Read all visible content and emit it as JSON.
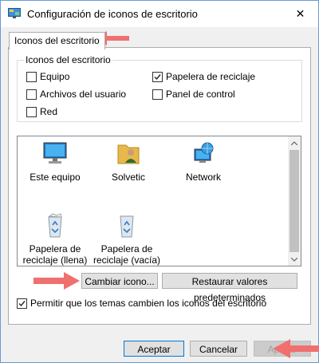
{
  "window": {
    "title": "Configuración de iconos de escritorio",
    "app_icon": "desktop-settings-icon",
    "close_glyph": "✕"
  },
  "tab": {
    "label": "Iconos del escritorio"
  },
  "group": {
    "title": "Iconos del escritorio",
    "checkboxes": [
      {
        "label": "Equipo",
        "checked": false
      },
      {
        "label": "Archivos del usuario",
        "checked": false
      },
      {
        "label": "Red",
        "checked": false
      },
      {
        "label": "Papelera de reciclaje",
        "checked": true
      },
      {
        "label": "Panel de control",
        "checked": false
      }
    ]
  },
  "icons": [
    {
      "label": "Este equipo",
      "icon": "computer-icon",
      "selected": false
    },
    {
      "label": "Solvetic",
      "icon": "user-folder-icon",
      "selected": false
    },
    {
      "label": "Network",
      "icon": "network-icon",
      "selected": false
    },
    {
      "label": "Papelera de\nreciclaje (llena)",
      "label_lines": [
        "Papelera de",
        "reciclaje (llena)"
      ],
      "icon": "recycle-bin-full-icon",
      "selected": false
    },
    {
      "label_lines": [
        "Papelera de",
        "reciclaje (vacía)"
      ],
      "icon": "recycle-bin-empty-icon",
      "selected": false
    }
  ],
  "buttons": {
    "change_icon": "Cambiar icono...",
    "restore_defaults": "Restaurar valores predeterminados",
    "accept": "Aceptar",
    "cancel": "Cancelar",
    "apply": "Aplicar"
  },
  "allow_themes": {
    "label": "Permitir que los temas cambien los iconos del escritorio",
    "checked": true
  },
  "colors": {
    "accent": "#0078d7",
    "annotation_arrow": "#f07070"
  }
}
